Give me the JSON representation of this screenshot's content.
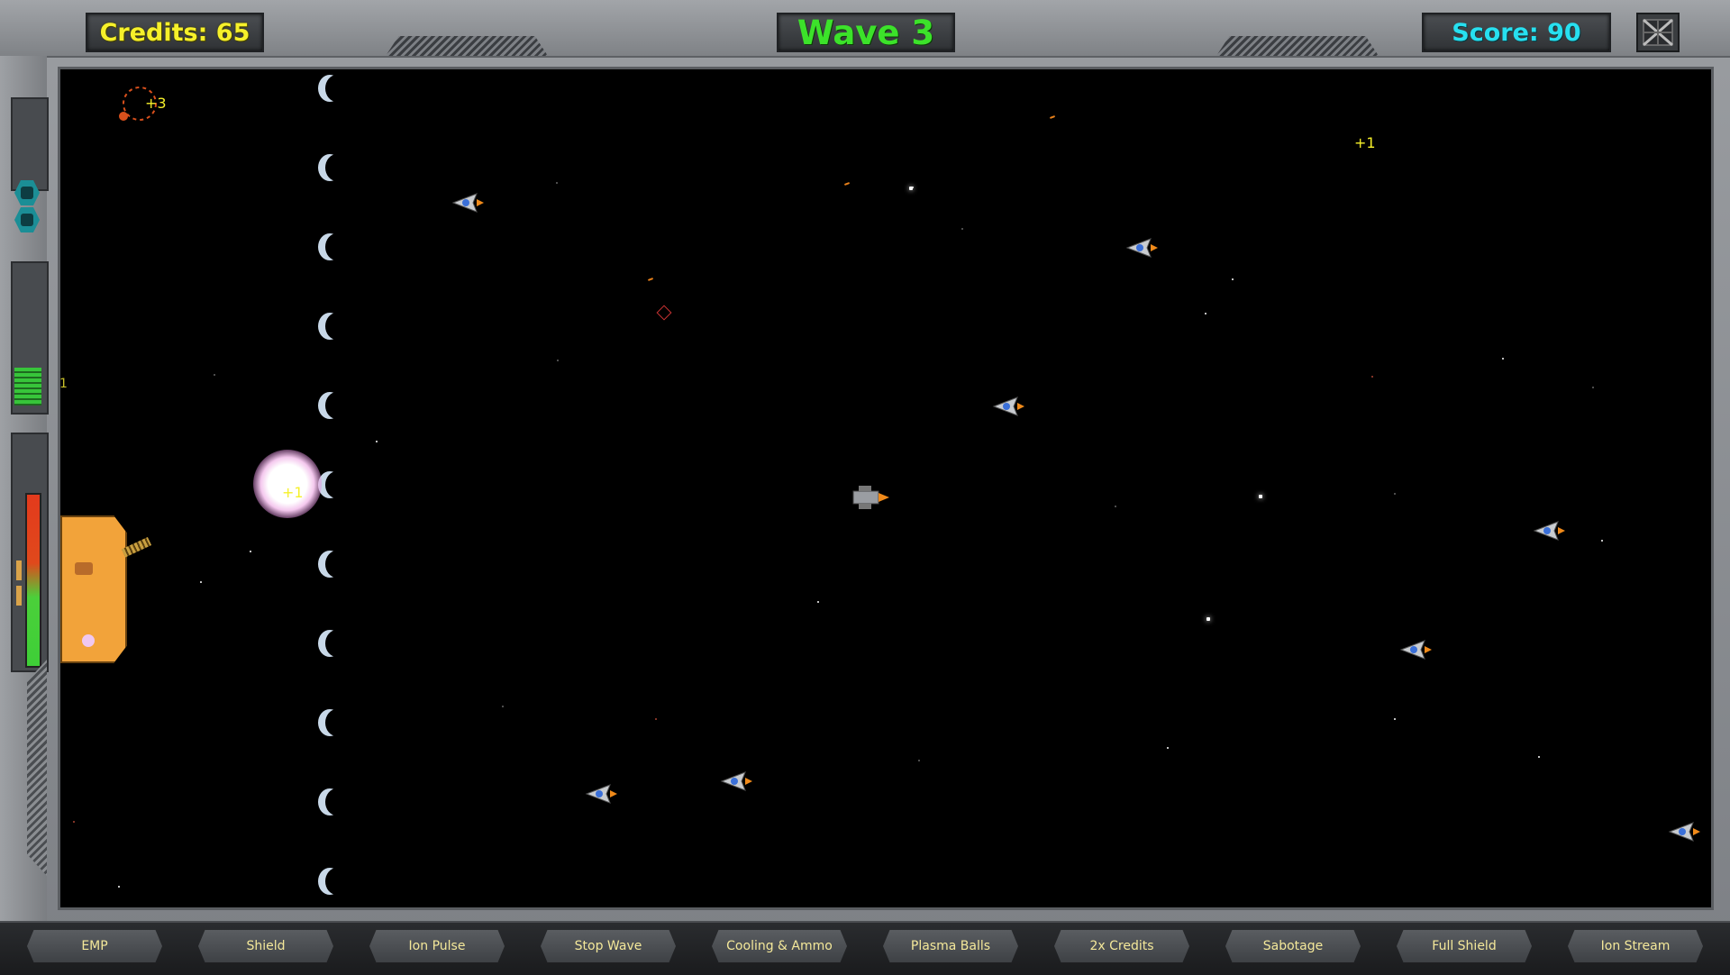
{
  "hud": {
    "credits": "Credits: 65",
    "wave": "Wave 3",
    "score": "Score: 90",
    "menu_icon": "menu-grid-icon"
  },
  "side_panel": {
    "counter_text": "1"
  },
  "floating_texts": [
    "+3",
    "+1",
    "+1"
  ],
  "abilities": [
    "EMP",
    "Shield",
    "Ion Pulse",
    "Stop Wave",
    "Cooling & Ammo",
    "Plasma Balls",
    "2x Credits",
    "Sabotage",
    "Full Shield",
    "Ion Stream"
  ],
  "colors": {
    "credits": "#f6f02a",
    "wave": "#3ce22a",
    "score": "#27e0f0",
    "ability_text": "#f4e89a",
    "station": "#f2a33a"
  }
}
